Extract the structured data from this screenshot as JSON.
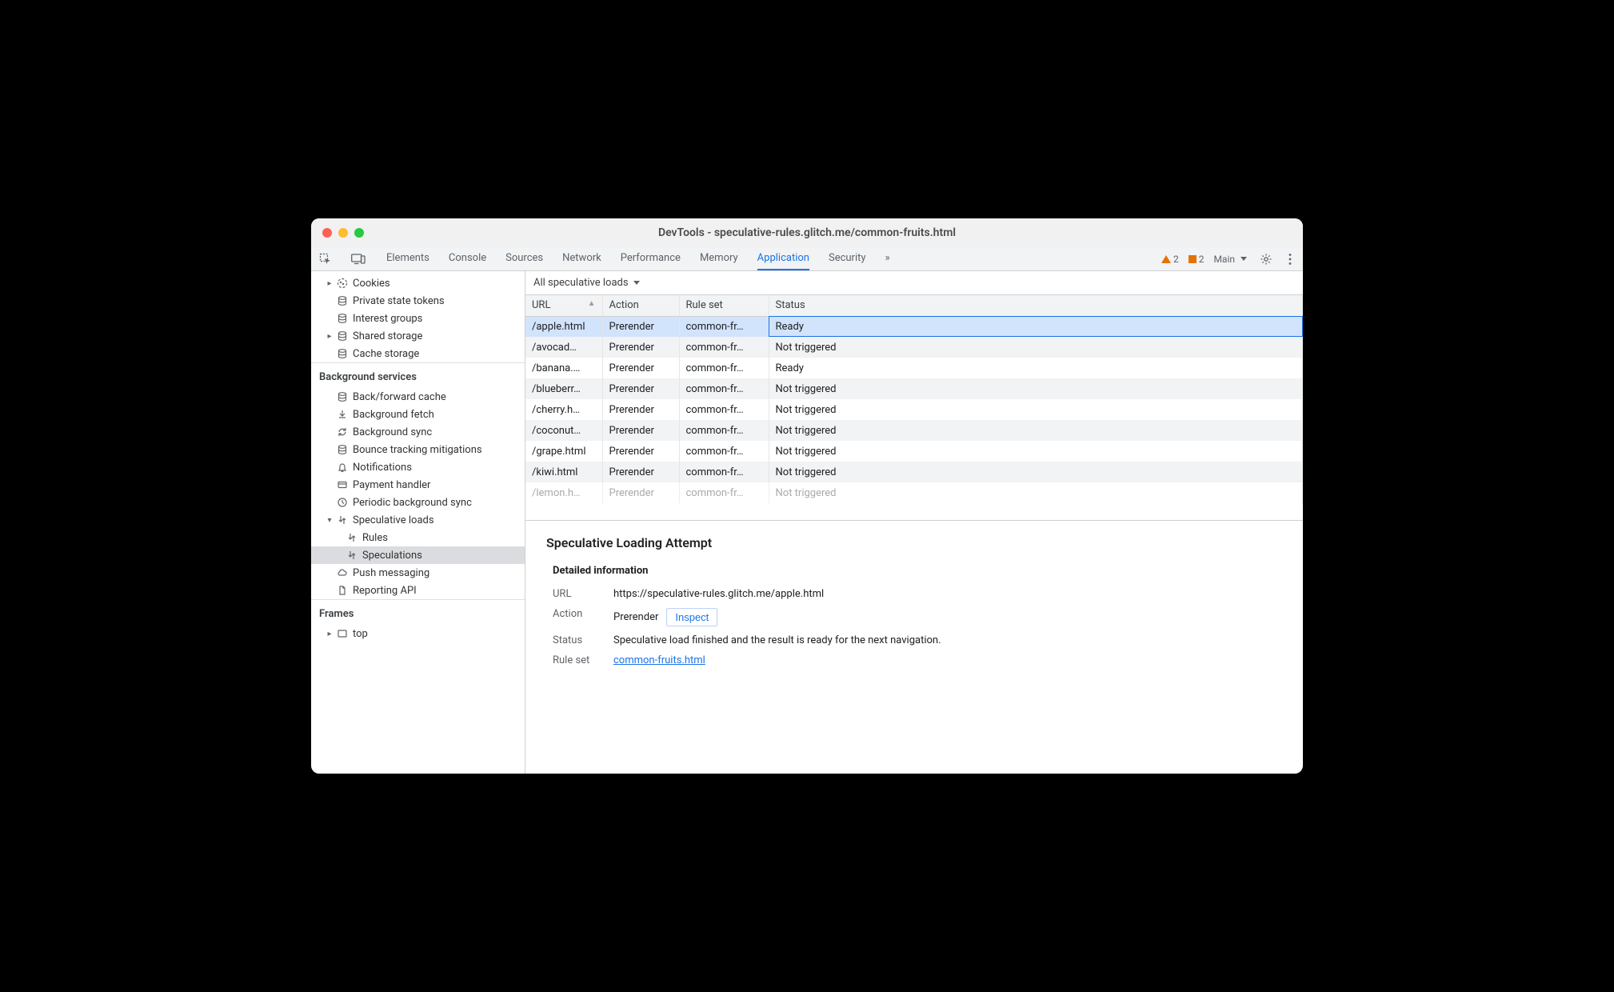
{
  "window": {
    "title": "DevTools - speculative-rules.glitch.me/common-fruits.html"
  },
  "tabs": {
    "items": [
      "Elements",
      "Console",
      "Sources",
      "Network",
      "Performance",
      "Memory",
      "Application",
      "Security"
    ],
    "active": "Application",
    "overflow_glyph": "»"
  },
  "toolbar_right": {
    "warning_count": "2",
    "issue_count": "2",
    "target_label": "Main",
    "gear_title": "Settings",
    "kebab_title": "More"
  },
  "sidebar": {
    "storage": {
      "cookies": "Cookies",
      "private_state_tokens": "Private state tokens",
      "interest_groups": "Interest groups",
      "shared_storage": "Shared storage",
      "cache_storage": "Cache storage"
    },
    "background_header": "Background services",
    "background": {
      "bfcache": "Back/forward cache",
      "bg_fetch": "Background fetch",
      "bg_sync": "Background sync",
      "bounce": "Bounce tracking mitigations",
      "notifications": "Notifications",
      "payment": "Payment handler",
      "periodic": "Periodic background sync",
      "speculative": "Speculative loads",
      "spec_rules": "Rules",
      "spec_speculations": "Speculations",
      "push": "Push messaging",
      "reporting": "Reporting API"
    },
    "frames_header": "Frames",
    "frames": {
      "top": "top"
    }
  },
  "filter": {
    "label": "All speculative loads"
  },
  "table": {
    "headers": {
      "url": "URL",
      "action": "Action",
      "ruleset": "Rule set",
      "status": "Status"
    },
    "rows": [
      {
        "url": "/apple.html",
        "action": "Prerender",
        "ruleset": "common-fr…",
        "status": "Ready",
        "selected": true
      },
      {
        "url": "/avocad…",
        "action": "Prerender",
        "ruleset": "common-fr…",
        "status": "Not triggered"
      },
      {
        "url": "/banana.…",
        "action": "Prerender",
        "ruleset": "common-fr…",
        "status": "Ready"
      },
      {
        "url": "/blueberr…",
        "action": "Prerender",
        "ruleset": "common-fr…",
        "status": "Not triggered"
      },
      {
        "url": "/cherry.h…",
        "action": "Prerender",
        "ruleset": "common-fr…",
        "status": "Not triggered"
      },
      {
        "url": "/coconut…",
        "action": "Prerender",
        "ruleset": "common-fr…",
        "status": "Not triggered"
      },
      {
        "url": "/grape.html",
        "action": "Prerender",
        "ruleset": "common-fr…",
        "status": "Not triggered"
      },
      {
        "url": "/kiwi.html",
        "action": "Prerender",
        "ruleset": "common-fr…",
        "status": "Not triggered"
      },
      {
        "url": "/lemon.h…",
        "action": "Prerender",
        "ruleset": "common-fr…",
        "status": "Not triggered",
        "faded": true
      }
    ]
  },
  "details": {
    "heading": "Speculative Loading Attempt",
    "subheading": "Detailed information",
    "labels": {
      "url": "URL",
      "action": "Action",
      "status": "Status",
      "ruleset": "Rule set"
    },
    "url": "https://speculative-rules.glitch.me/apple.html",
    "action": "Prerender",
    "inspect_label": "Inspect",
    "status": "Speculative load finished and the result is ready for the next navigation.",
    "ruleset": "common-fruits.html"
  }
}
